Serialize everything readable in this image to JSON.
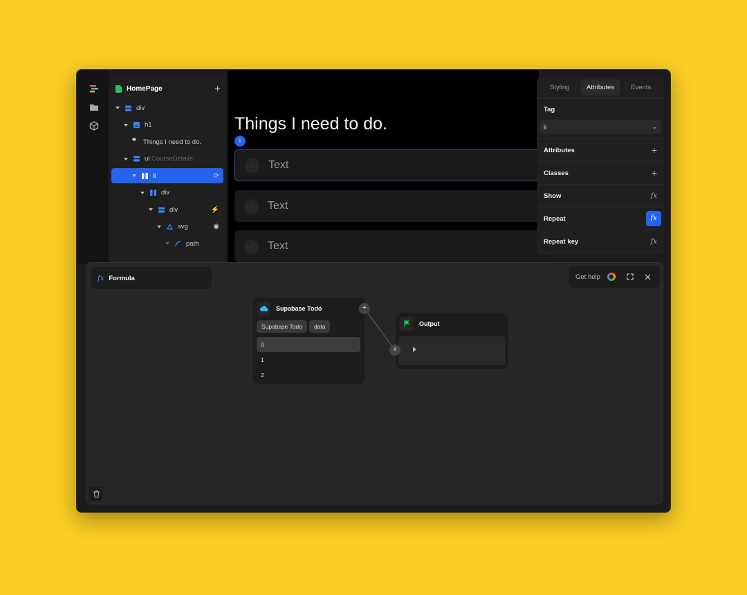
{
  "colors": {
    "background": "#F9CD24",
    "accent": "#2463EB",
    "panel": "#1F1F1F"
  },
  "rail": {
    "icons": [
      "logo-icon",
      "folder-icon",
      "package-icon"
    ]
  },
  "tree": {
    "title": "HomePage",
    "nodes": [
      {
        "label": "div",
        "icon": "stack-icon"
      },
      {
        "label": "h1",
        "icon": "heading-icon"
      },
      {
        "label": "Things I need to do.",
        "icon": "quote-icon"
      },
      {
        "label": "ul",
        "class": ".CourseDetails",
        "icon": "stack-icon"
      },
      {
        "label": "li",
        "icon": "columns-icon",
        "action": "repeat-icon",
        "selected": true
      },
      {
        "label": "div",
        "icon": "columns-icon"
      },
      {
        "label": "div",
        "icon": "stack-icon",
        "action": "bolt-icon"
      },
      {
        "label": "svg",
        "icon": "vector-icon",
        "action": "eye-icon"
      },
      {
        "label": "path",
        "icon": "path-icon"
      }
    ]
  },
  "canvas": {
    "heading": "Things I need to do.",
    "badge": "li",
    "rows": [
      "Text",
      "Text",
      "Text"
    ]
  },
  "props": {
    "tabs": [
      "Styling",
      "Attributes",
      "Events"
    ],
    "active_tab": "Attributes",
    "tag_label": "Tag",
    "tag_value": "li",
    "rows": [
      {
        "label": "Attributes",
        "action": "+"
      },
      {
        "label": "Classes",
        "action": "+"
      },
      {
        "label": "Show",
        "action": "fx"
      },
      {
        "label": "Repeat",
        "action": "fx",
        "active": true
      },
      {
        "label": "Repeat key",
        "action": "fx"
      }
    ]
  },
  "formula": {
    "title": "Formula",
    "fx": "fx",
    "help": "Get help",
    "source": {
      "title": "Supabase Todo",
      "chips": [
        "Supabase Todo",
        "data"
      ],
      "items": [
        "0",
        "1",
        "2"
      ],
      "highlighted": "0"
    },
    "output": {
      "title": "Output"
    }
  }
}
